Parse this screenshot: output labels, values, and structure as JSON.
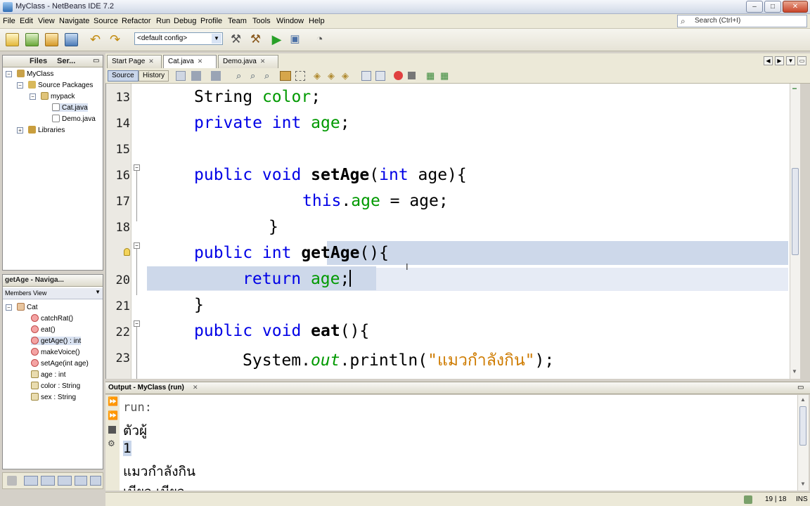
{
  "window": {
    "title": "MyClass - NetBeans IDE 7.2"
  },
  "menu": [
    "File",
    "Edit",
    "View",
    "Navigate",
    "Source",
    "Refactor",
    "Run",
    "Debug",
    "Profile",
    "Team",
    "Tools",
    "Window",
    "Help"
  ],
  "search": {
    "placeholder": "Search (Ctrl+I)"
  },
  "toolbar": {
    "config": "<default config>"
  },
  "projects_panel": {
    "tabs": [
      "Files",
      "Ser..."
    ],
    "tree": [
      {
        "label": "MyClass"
      },
      {
        "label": "Source Packages"
      },
      {
        "label": "mypack"
      },
      {
        "label": "Cat.java"
      },
      {
        "label": "Demo.java"
      },
      {
        "label": "Libraries"
      }
    ]
  },
  "navigator": {
    "title": "getAge - Naviga...",
    "view": "Members View",
    "class": "Cat",
    "members": [
      "catchRat()",
      "eat()",
      "getAge() : int",
      "makeVoice()",
      "setAge(int age)",
      "age : int",
      "color : String",
      "sex : String"
    ]
  },
  "editor": {
    "tabs": [
      "Start Page",
      "Cat.java",
      "Demo.java"
    ],
    "view_buttons": [
      "Source",
      "History"
    ],
    "line_numbers": [
      "13",
      "14",
      "15",
      "16",
      "17",
      "18",
      "",
      "20",
      "21",
      "22",
      "23"
    ],
    "lines": [
      [
        [
          "String ",
          ""
        ],
        [
          "color",
          "fld"
        ],
        [
          ";",
          ""
        ]
      ],
      [
        [
          "private int ",
          "kw"
        ],
        [
          "age",
          "fld"
        ],
        [
          ";",
          ""
        ]
      ],
      [],
      [
        [
          "public void ",
          "kw"
        ],
        [
          "setAge",
          "mth"
        ],
        [
          "(",
          ""
        ],
        [
          "int ",
          "kw"
        ],
        [
          "age){",
          ""
        ]
      ],
      [
        [
          "this",
          "kw"
        ],
        [
          ".",
          ""
        ],
        [
          "age",
          "fld"
        ],
        [
          " = age;",
          ""
        ]
      ],
      [
        [
          "}",
          ""
        ]
      ],
      [
        [
          "public int ",
          "kw"
        ],
        [
          "getAge",
          "mth hl"
        ],
        [
          "(){",
          ""
        ]
      ],
      [
        [
          "return ",
          "kw hl"
        ],
        [
          "age",
          "fld hl"
        ],
        [
          ";",
          "hl"
        ]
      ],
      [
        [
          "}",
          ""
        ]
      ],
      [
        [
          "public void ",
          "kw"
        ],
        [
          "eat",
          "mth"
        ],
        [
          "(){",
          ""
        ]
      ],
      [
        [
          "System.",
          ""
        ],
        [
          "out",
          "itl"
        ],
        [
          ".println(",
          ""
        ],
        [
          "\"แมวกำลังกิน\"",
          "str"
        ],
        [
          ");",
          ""
        ]
      ]
    ]
  },
  "output": {
    "title": "Output - MyClass (run)",
    "lines": [
      "run:",
      "ตัวผู้",
      "1",
      "แมวกำลังกิน",
      "เมียว เมียว"
    ]
  },
  "status": {
    "position": "19 | 18",
    "mode": "INS"
  }
}
